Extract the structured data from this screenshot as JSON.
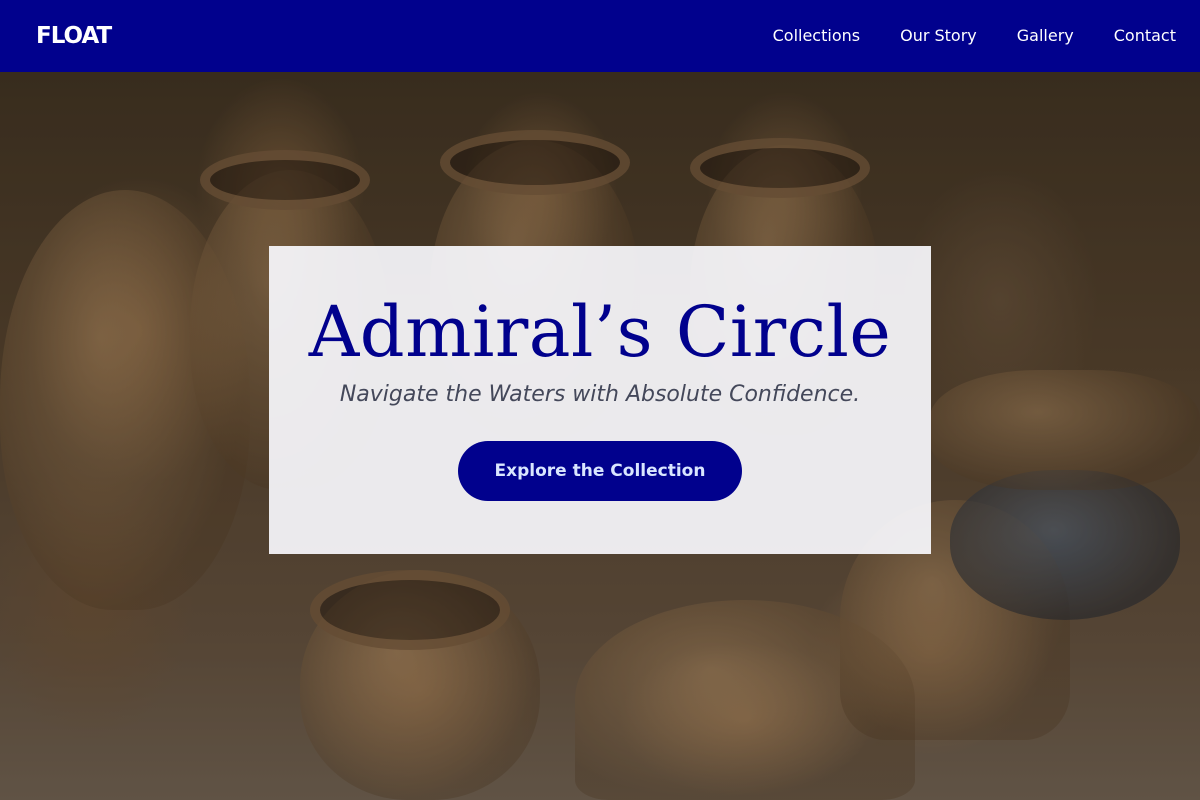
{
  "navbar": {
    "brand": "FLOAT",
    "links": [
      {
        "label": "Collections"
      },
      {
        "label": "Our Story"
      },
      {
        "label": "Gallery"
      },
      {
        "label": "Contact"
      }
    ]
  },
  "hero": {
    "title": "Admiral’s Circle",
    "subtitle": "Navigate the Waters with Absolute Confidence.",
    "cta_label": "Explore the Collection"
  },
  "colors": {
    "primary": "#01018d",
    "card_background": "#f8f8fc",
    "subtitle_text": "#44485a",
    "cta_text": "#d9e6ff"
  }
}
